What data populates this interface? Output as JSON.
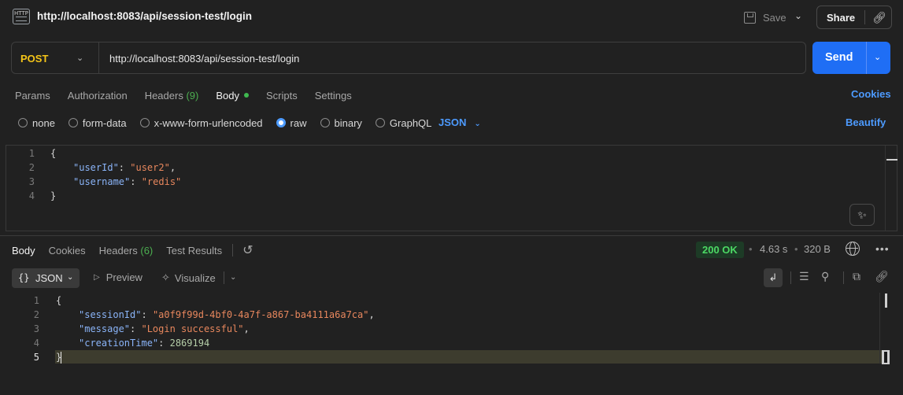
{
  "header": {
    "title": "http://localhost:8083/api/session-test/login",
    "save_label": "Save",
    "share_label": "Share",
    "icon_text": "HTTP"
  },
  "request": {
    "method": "POST",
    "url": "http://localhost:8083/api/session-test/login",
    "send_label": "Send"
  },
  "request_tabs": [
    {
      "label": "Params",
      "count": ""
    },
    {
      "label": "Authorization",
      "count": ""
    },
    {
      "label": "Headers",
      "count": "(9)"
    },
    {
      "label": "Body",
      "count": ""
    },
    {
      "label": "Scripts",
      "count": ""
    },
    {
      "label": "Settings",
      "count": ""
    }
  ],
  "cookies_label": "Cookies",
  "body_types": [
    "none",
    "form-data",
    "x-www-form-urlencoded",
    "raw",
    "binary",
    "GraphQL"
  ],
  "body_type_selected": "raw",
  "body_language": "JSON",
  "beautify_label": "Beautify",
  "request_body": {
    "line_numbers": [
      "1",
      "2",
      "3",
      "4"
    ],
    "open": "{",
    "close": "}",
    "k1": "\"userId\"",
    "v1": "\"user2\"",
    "k2": "\"username\"",
    "v2": "\"redis\""
  },
  "response_tabs": [
    {
      "label": "Body",
      "count": ""
    },
    {
      "label": "Cookies",
      "count": ""
    },
    {
      "label": "Headers",
      "count": "(6)"
    },
    {
      "label": "Test Results",
      "count": ""
    }
  ],
  "response_meta": {
    "status": "200 OK",
    "time": "4.63 s",
    "size": "320 B"
  },
  "response_toolbar": {
    "format": "JSON",
    "preview_label": "Preview",
    "visualize_label": "Visualize"
  },
  "response_body": {
    "line_numbers": [
      "1",
      "2",
      "3",
      "4",
      "5"
    ],
    "open": "{",
    "close": "}",
    "k1": "\"sessionId\"",
    "v1": "\"a0f9f99d-4bf0-4a7f-a867-ba4111a6a7ca\"",
    "k2": "\"message\"",
    "v2": "\"Login successful\"",
    "k3": "\"creationTime\"",
    "v3": "2869194"
  },
  "colors": {
    "accent": "#1f6ef5",
    "link": "#4d9bff",
    "method": "#f5c518",
    "status_ok": "#4cd964"
  }
}
